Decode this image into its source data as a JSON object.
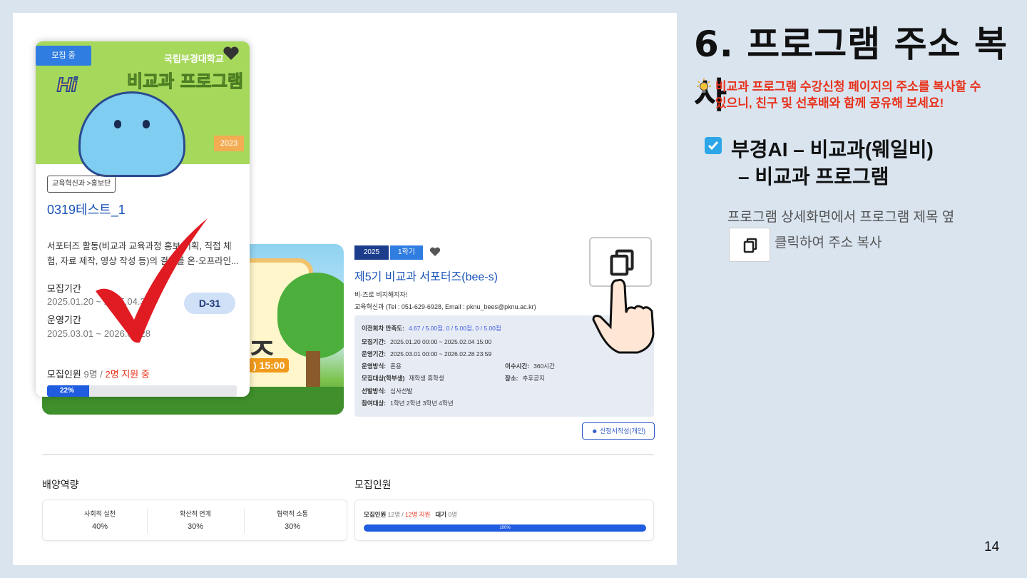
{
  "slide": {
    "title": "6. 프로그램 주소 복사",
    "tip_line1": "비교과 프로그램 수강신청 페이지의 주소를 복사할 수",
    "tip_line2": "있으니, 친구 및 선후배와 함께 공유해 보세요!",
    "menu_line1": "부경AI – 비교과(웨일비)",
    "menu_line2": "– 비교과 프로그램",
    "desc_line1": "프로그램 상세화면에서 프로그램 제목 옆",
    "desc_line2": "클릭하여 주소 복사",
    "page_number": "14",
    "colors": {
      "accent_red": "#e8321c",
      "check_blue": "#2ca6e8"
    }
  },
  "card": {
    "status_badge": "모집 중",
    "univ_name": "국립부경대학교",
    "image_title": "비교과 프로그램",
    "image_hi": "Hi",
    "image_year": "2023",
    "dept_tag": "교육혁신과 >홍보단",
    "title": "0319테스트_1",
    "description": "서포터즈 활동(비교과 교육과정 홍보 기획, 직접 체험, 자료 제작, 영상 작성 등)의 결과를 온·오프라인...",
    "recruit_period_label": "모집기간",
    "recruit_period_value": "2025.01.20 ~ 2025.04.30",
    "dday": "D-31",
    "operation_period_label": "운영기간",
    "operation_period_value": "2025.03.01 ~ 2026.02.28",
    "recruit_label": "모집인원",
    "recruit_count": "9명",
    "recruit_applied": "2명 지원 중",
    "progress_label": "22%",
    "progress_fraction": 0.22
  },
  "detail": {
    "tag_year": "2025",
    "tag_term": "1학기",
    "banner_big": "즈",
    "banner_time": ") 15:00",
    "title": "제5기 비교과 서포터즈(bee-s)",
    "subtitle": "비-즈로 비지해지자!",
    "contact": "교육혁신과 (Tel : 051-629-6928, Email : pknu_bees@pknu.ac.kr)",
    "rows": [
      {
        "label": "이전회차 만족도:",
        "value": "4.67 / 5.00점,  0 / 5.00점,  0 / 5.00점",
        "blue": true
      },
      {
        "label": "모집기간:",
        "value": "2025.01.20 00:00 ~ 2025.02.04 15:00"
      },
      {
        "label": "운영기간:",
        "value": "2025.03.01 00:00 ~ 2026.02.28 23:59"
      },
      {
        "label": "운영방식:",
        "value": "혼용"
      },
      {
        "label": "모집대상(학부생)",
        "value": "재학생 휴학생"
      },
      {
        "label": "선발방식:",
        "value": "심사선발"
      },
      {
        "label": "참여대상:",
        "value": "1학년 2학년 3학년 4학년"
      }
    ],
    "right_rows": [
      {
        "label": "이수시간:",
        "value": "360시간"
      },
      {
        "label": "장소:",
        "value": "추후공지"
      }
    ],
    "apply_button": "신청서작성(개인)",
    "capacity_title": "배양역량",
    "capacities": [
      {
        "label": "사회적 실천",
        "value": "40%"
      },
      {
        "label": "확산적 연계",
        "value": "30%"
      },
      {
        "label": "협력적 소통",
        "value": "30%"
      }
    ],
    "recruit_title": "모집인원",
    "recruit_label": "모집인원",
    "recruit_total": "12명 /",
    "recruit_applied": "12명 지원",
    "wait_label": "대기",
    "wait_value": "0명",
    "recruit_bar_label": "100%",
    "recruit_fraction": 1.0
  }
}
